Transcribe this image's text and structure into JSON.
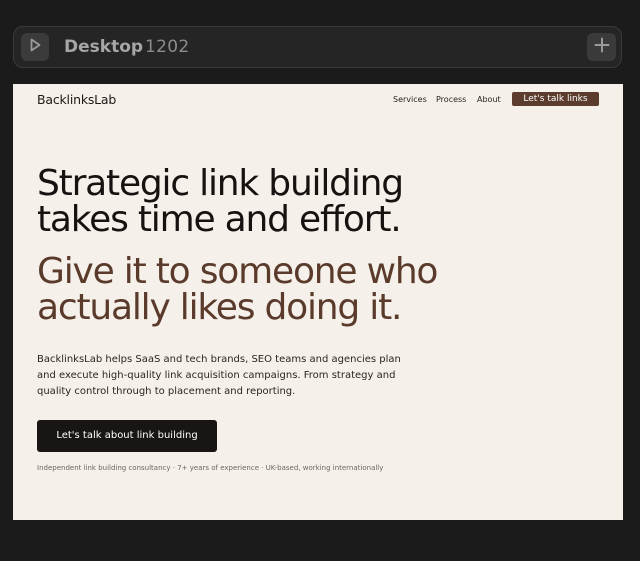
{
  "toolbar": {
    "title": "Desktop",
    "width_value": "1202"
  },
  "site": {
    "logo": "BacklinksLab",
    "nav": {
      "services": "Services",
      "process": "Process",
      "about": "About",
      "cta": "Let's talk links"
    },
    "hero": {
      "headline_line1": "Strategic link building",
      "headline_line2": "takes time and effort.",
      "subhead_line1": "Give it to someone who",
      "subhead_line2": "actually likes doing it.",
      "body": "BacklinksLab helps SaaS and tech brands, SEO teams and agencies plan and execute high-quality link acquisition campaigns. From strategy and quality control through to placement and reporting.",
      "cta": "Let's talk about link building",
      "footnote": "Independent link building consultancy · 7+ years of experience · UK-based, working internationally"
    }
  },
  "colors": {
    "app_background": "#1b1b1b",
    "page_background": "#f5f0e9",
    "accent_brown": "#5c3c2d",
    "headline_dark": "#151210",
    "cta_dark": "#191513"
  },
  "icons": {
    "play": "play-icon",
    "add": "plus-icon"
  }
}
